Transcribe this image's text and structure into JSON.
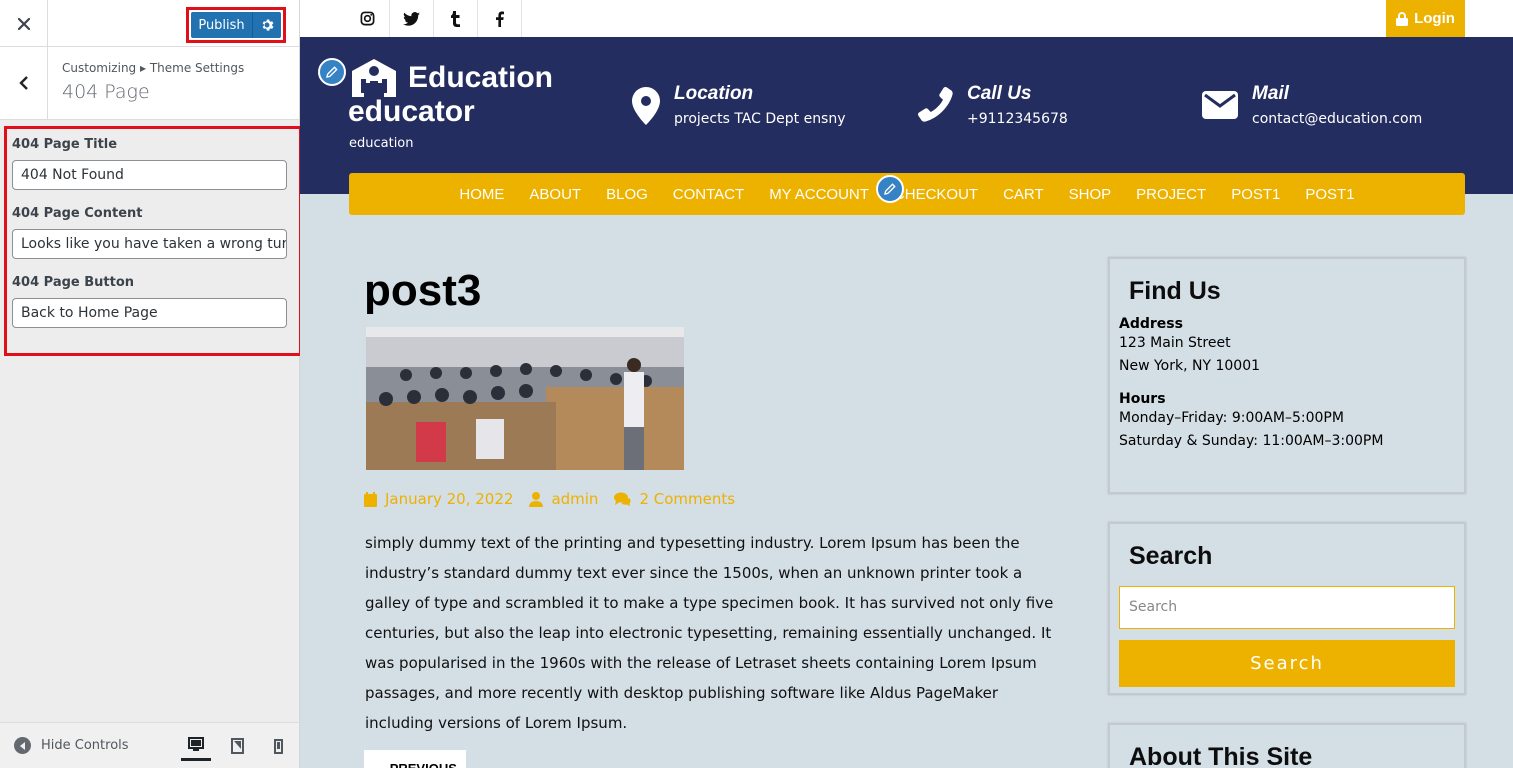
{
  "customizer": {
    "publish_label": "Publish",
    "breadcrumb": "Customizing ▸ Theme Settings",
    "section_title": "404 Page",
    "controls": [
      {
        "label": "404 Page Title",
        "value": "404 Not Found"
      },
      {
        "label": "404 Page Content",
        "value": "Looks like you have taken a wrong turn&l"
      },
      {
        "label": "404 Page Button",
        "value": "Back to Home Page"
      }
    ],
    "hide_controls_label": "Hide Controls"
  },
  "site": {
    "login_label": "Login",
    "logo_title_line1": "Education",
    "logo_title_line2": "educator",
    "tagline": "education",
    "contact": [
      {
        "title": "Location",
        "text": "projects TAC Dept ensny",
        "icon": "map-pin-icon"
      },
      {
        "title": "Call Us",
        "text": "+9112345678",
        "icon": "phone-icon"
      },
      {
        "title": "Mail",
        "text": "contact@education.com",
        "icon": "envelope-icon"
      }
    ],
    "nav": [
      "HOME",
      "ABOUT",
      "BLOG",
      "CONTACT",
      "MY ACCOUNT",
      "CHECKOUT",
      "CART",
      "SHOP",
      "PROJECT",
      "POST1",
      "POST1"
    ],
    "post": {
      "title": "post3",
      "date": "January 20, 2022",
      "author": "admin",
      "comments": "2 Comments",
      "body": "simply dummy text of the printing and typesetting industry. Lorem Ipsum has been the industry’s standard dummy text ever since the 1500s, when an unknown printer took a galley of type and scrambled it to make a type specimen book. It has survived not only five centuries, but also the leap into electronic typesetting, remaining essentially unchanged. It was popularised in the 1960s with the release of Letraset sheets containing Lorem Ipsum passages, and more recently with desktop publishing software like Aldus PageMaker including versions of Lorem Ipsum.",
      "previous_label": "← PREVIOUS"
    },
    "widgets": {
      "find_us": {
        "title": "Find Us",
        "address_label": "Address",
        "address_line1": "123 Main Street",
        "address_line2": "New York, NY 10001",
        "hours_label": "Hours",
        "hours_line1": "Monday–Friday: 9:00AM–5:00PM",
        "hours_line2": "Saturday & Sunday: 11:00AM–3:00PM"
      },
      "search": {
        "title": "Search",
        "placeholder": "Search",
        "button_label": "Search"
      },
      "about": {
        "title": "About This Site"
      }
    }
  },
  "colors": {
    "accent": "#edb100",
    "header_bg": "#242d5f",
    "wp_blue": "#2271b1",
    "highlight_red": "#e0101a"
  }
}
